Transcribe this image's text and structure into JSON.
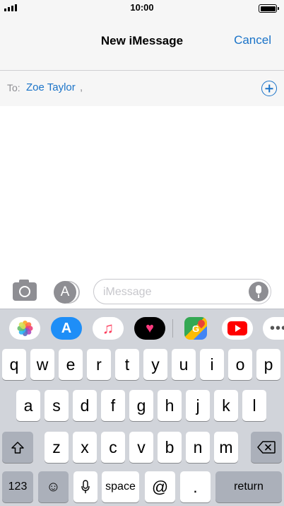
{
  "status_bar": {
    "time": "10:00",
    "signal_bars": 4,
    "battery_level": 1.0
  },
  "nav": {
    "title": "New iMessage",
    "cancel_label": "Cancel"
  },
  "recipients": {
    "to_label": "To:",
    "items": [
      {
        "name": "Zoe Taylor"
      }
    ],
    "separator": ",",
    "add_icon": "plus-circle-icon"
  },
  "compose": {
    "camera_icon": "camera-icon",
    "apps_icon": "app-store-icon",
    "apps_glyph": "A",
    "placeholder": "iMessage",
    "mic_icon": "microphone-icon"
  },
  "app_drawer": {
    "apps": [
      {
        "name": "Photos",
        "icon": "photos-icon"
      },
      {
        "name": "App Store",
        "icon": "app-store-icon",
        "glyph": "A"
      },
      {
        "name": "Music",
        "icon": "music-note-icon",
        "glyph": "♫"
      },
      {
        "name": "Digital Touch",
        "icon": "heart-icon",
        "glyph": "♥"
      },
      {
        "name": "Google Maps",
        "icon": "google-maps-icon",
        "glyph": "G"
      },
      {
        "name": "YouTube",
        "icon": "youtube-icon"
      },
      {
        "name": "More",
        "icon": "more-icon",
        "glyph": "•••"
      }
    ]
  },
  "keyboard": {
    "row1": [
      "q",
      "w",
      "e",
      "r",
      "t",
      "y",
      "u",
      "i",
      "o",
      "p"
    ],
    "row2": [
      "a",
      "s",
      "d",
      "f",
      "g",
      "h",
      "j",
      "k",
      "l"
    ],
    "row3": [
      "z",
      "x",
      "c",
      "v",
      "b",
      "n",
      "m"
    ],
    "numbers_label": "123",
    "emoji_glyph": "☺",
    "mic_glyph": "🎙",
    "space_label": "space",
    "at_label": "@",
    "period_label": ".",
    "return_label": "return"
  },
  "colors": {
    "accent": "#1a73c8",
    "bar_background": "#f6f6f6",
    "keyboard_background": "#d1d4da",
    "dark_key": "#abb0ba",
    "icon_gray": "#8e8e93"
  }
}
